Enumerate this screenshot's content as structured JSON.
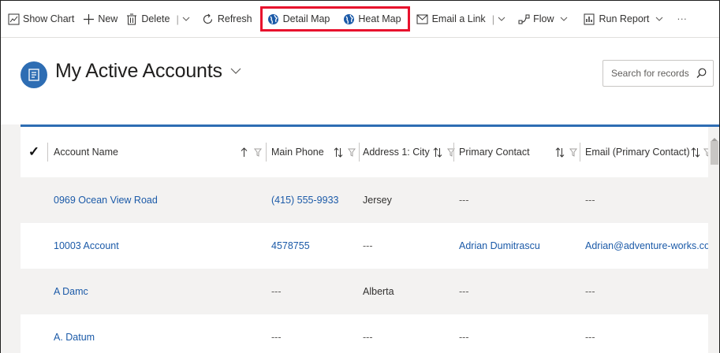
{
  "commandbar": {
    "show_chart": "Show Chart",
    "new": "New",
    "delete": "Delete",
    "refresh": "Refresh",
    "detail_map": "Detail Map",
    "heat_map": "Heat Map",
    "email_link": "Email a Link",
    "flow": "Flow",
    "run_report": "Run Report",
    "more": "···",
    "highlight_color": "#e8112d"
  },
  "header": {
    "title": "My Active Accounts",
    "search_placeholder": "Search for records",
    "accent_color": "#2e6db3"
  },
  "grid": {
    "columns": [
      {
        "label": "Account Name",
        "sort": "ascending"
      },
      {
        "label": "Main Phone",
        "sort": "none"
      },
      {
        "label": "Address 1: City",
        "sort": "none"
      },
      {
        "label": "Primary Contact",
        "sort": "none"
      },
      {
        "label": "Email (Primary Contact)",
        "sort": "none"
      }
    ],
    "rows": [
      {
        "name": "0969 Ocean View Road",
        "phone": "(415) 555-9933",
        "city": "Jersey",
        "contact": "---",
        "email": "---"
      },
      {
        "name": "10003 Account",
        "phone": "4578755",
        "city": "---",
        "contact": "Adrian Dumitrascu",
        "email": "Adrian@adventure-works.com"
      },
      {
        "name": "A Damc",
        "phone": "---",
        "city": "Alberta",
        "contact": "---",
        "email": "---"
      },
      {
        "name": "A. Datum",
        "phone": "---",
        "city": "---",
        "contact": "---",
        "email": "---"
      }
    ]
  }
}
